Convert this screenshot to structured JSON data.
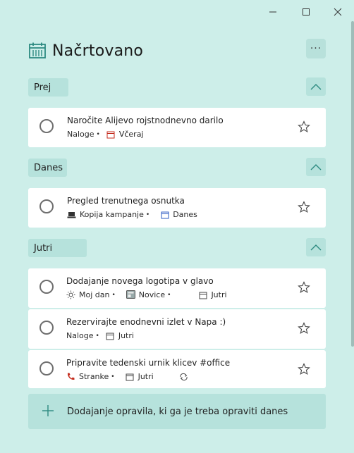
{
  "window": {
    "minimize": "minimize",
    "maximize": "maximize",
    "close": "close"
  },
  "header": {
    "title": "Načrtovano",
    "icon": "calendar-icon",
    "more_label": "···"
  },
  "sections": [
    {
      "label": "Prej",
      "tasks": [
        {
          "name": "Naročite Alijevo rojstnodnevno darilo",
          "list": "Naloge",
          "due": "Včeraj",
          "due_color": "#c42b1c"
        }
      ]
    },
    {
      "label": "Danes",
      "tasks": [
        {
          "name": "Pregled trenutnega osnutka",
          "list": "Kopija kampanje",
          "due": "Danes",
          "due_color": "#2b59c3"
        }
      ]
    },
    {
      "label": "Jutri",
      "tasks": [
        {
          "name": "Dodajanje novega logotipa v glavo",
          "myday": "Moj dan",
          "list": "Novice",
          "due": "Jutri"
        },
        {
          "name": "Rezervirajte enodnevni izlet v Napa :)",
          "list": "Naloge",
          "due": "Jutri"
        },
        {
          "name": "Pripravite tedenski urnik klicev #office",
          "list": "Stranke",
          "due": "Jutri",
          "repeat": true
        }
      ]
    }
  ],
  "add_task": {
    "label": "Dodajanje opravila, ki ga je treba opraviti danes"
  },
  "colors": {
    "background": "#cdeee9",
    "section_bg": "#b6e2dc",
    "accent": "#2d8a81",
    "overdue": "#c42b1c",
    "today": "#2b59c3"
  }
}
